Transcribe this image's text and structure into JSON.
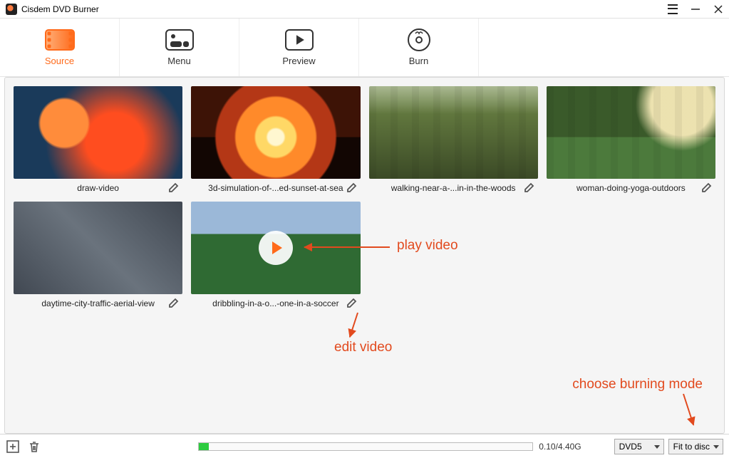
{
  "app": {
    "title": "Cisdem DVD Burner"
  },
  "tabs": [
    {
      "label": "Source",
      "active": true
    },
    {
      "label": "Menu",
      "active": false
    },
    {
      "label": "Preview",
      "active": false
    },
    {
      "label": "Burn",
      "active": false
    }
  ],
  "videos": [
    {
      "caption": "draw-video"
    },
    {
      "caption": "3d-simulation-of-...ed-sunset-at-sea"
    },
    {
      "caption": "walking-near-a-...in-in-the-woods"
    },
    {
      "caption": "woman-doing-yoga-outdoors"
    },
    {
      "caption": "daytime-city-traffic-aerial-view"
    },
    {
      "caption": "dribbling-in-a-o...-one-in-a-soccer"
    }
  ],
  "annotations": {
    "play": "play video",
    "edit": "edit video",
    "mode": "choose burning mode"
  },
  "bottom": {
    "size": "0.10/4.40G",
    "disc_type": "DVD5",
    "fit_mode": "Fit to disc"
  }
}
